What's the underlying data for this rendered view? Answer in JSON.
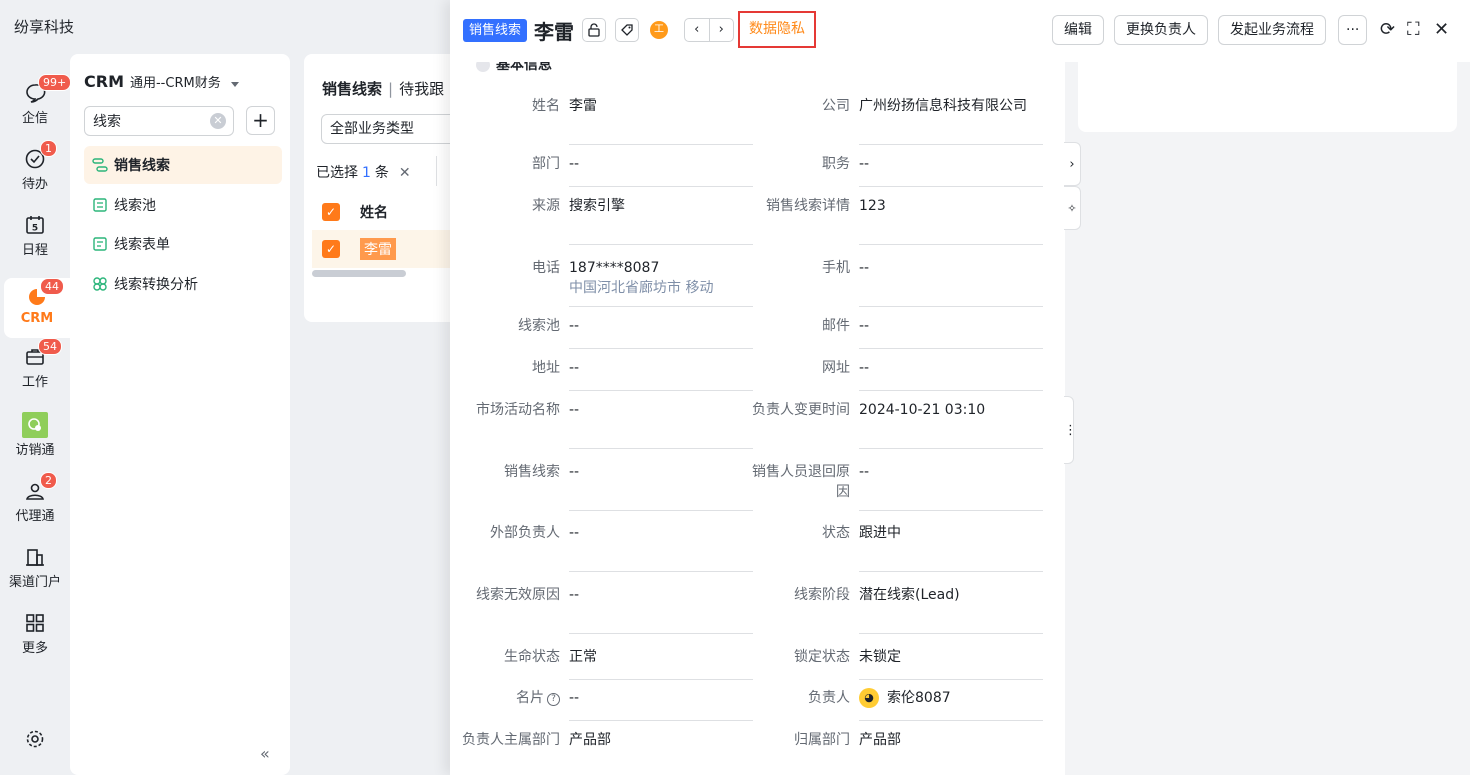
{
  "app": {
    "title": "纷享科技"
  },
  "rail": [
    {
      "label": "企信",
      "badge": "99+",
      "icon": "chat-bubble-icon"
    },
    {
      "label": "待办",
      "badge": "1",
      "icon": "check-circle-icon"
    },
    {
      "label": "日程",
      "badge": "",
      "icon": "calendar-icon",
      "day": "5"
    },
    {
      "label": "CRM",
      "badge": "44",
      "icon": "crm-icon"
    },
    {
      "label": "工作",
      "badge": "54",
      "icon": "briefcase-icon"
    },
    {
      "label": "访销通",
      "badge": "",
      "icon": "visit-app-icon"
    },
    {
      "label": "代理通",
      "badge": "2",
      "icon": "agent-icon"
    },
    {
      "label": "渠道门户",
      "badge": "",
      "icon": "building-icon"
    },
    {
      "label": "更多",
      "badge": "",
      "icon": "grid-icon"
    }
  ],
  "nav": {
    "title": "CRM",
    "subtitle": "通用--CRM财务",
    "search_value": "线索",
    "items": [
      {
        "label": "销售线索",
        "icon": "lead-flow-icon"
      },
      {
        "label": "线索池",
        "icon": "pool-icon"
      },
      {
        "label": "线索表单",
        "icon": "form-icon"
      },
      {
        "label": "线索转换分析",
        "icon": "analysis-icon"
      }
    ],
    "collapse": "«"
  },
  "list": {
    "title": "销售线索",
    "subtitle": "待我跟",
    "type_select": "全部业务类型",
    "selected_prefix": "已选择",
    "selected_count": "1",
    "selected_suffix": "条",
    "column_name": "姓名",
    "rows": [
      {
        "name": "李雷"
      }
    ]
  },
  "detail": {
    "tag": "销售线索",
    "name": "李雷",
    "privacy": "数据隐私",
    "buttons": {
      "edit": "编辑",
      "change_owner": "更换负责人",
      "start_flow": "发起业务流程",
      "more": "···"
    },
    "section_title": "基本信息",
    "fields_left": [
      {
        "label": "姓名",
        "value": "李雷"
      },
      {
        "label": "部门",
        "value": "--"
      },
      {
        "label": "来源",
        "value": "搜索引擎"
      },
      {
        "label": "电话",
        "value": "187****8087",
        "sub": "中国河北省廊坊市 移动"
      },
      {
        "label": "线索池",
        "value": "--"
      },
      {
        "label": "地址",
        "value": "--"
      },
      {
        "label": "市场活动名称",
        "value": "--"
      },
      {
        "label": "销售线索",
        "value": "--"
      },
      {
        "label": "外部负责人",
        "value": "--"
      },
      {
        "label": "线索无效原因",
        "value": "--"
      },
      {
        "label": "生命状态",
        "value": "正常"
      },
      {
        "label": "名片",
        "value": "--"
      },
      {
        "label": "负责人主属部门",
        "value": "产品部"
      }
    ],
    "fields_right": [
      {
        "label": "公司",
        "value": "广州纷扬信息科技有限公司"
      },
      {
        "label": "职务",
        "value": "--"
      },
      {
        "label": "销售线索详情",
        "value": "123"
      },
      {
        "label": "手机",
        "value": "--"
      },
      {
        "label": "邮件",
        "value": "--"
      },
      {
        "label": "网址",
        "value": "--"
      },
      {
        "label": "负责人变更时间",
        "value": "2024-10-21 03:10"
      },
      {
        "label": "销售人员退回原因",
        "value": "--"
      },
      {
        "label": "状态",
        "value": "跟进中"
      },
      {
        "label": "线索阶段",
        "value": "潜在线索(Lead)"
      },
      {
        "label": "锁定状态",
        "value": "未锁定"
      },
      {
        "label": "负责人",
        "value": "索伦8087"
      },
      {
        "label": "归属部门",
        "value": "产品部"
      }
    ]
  }
}
